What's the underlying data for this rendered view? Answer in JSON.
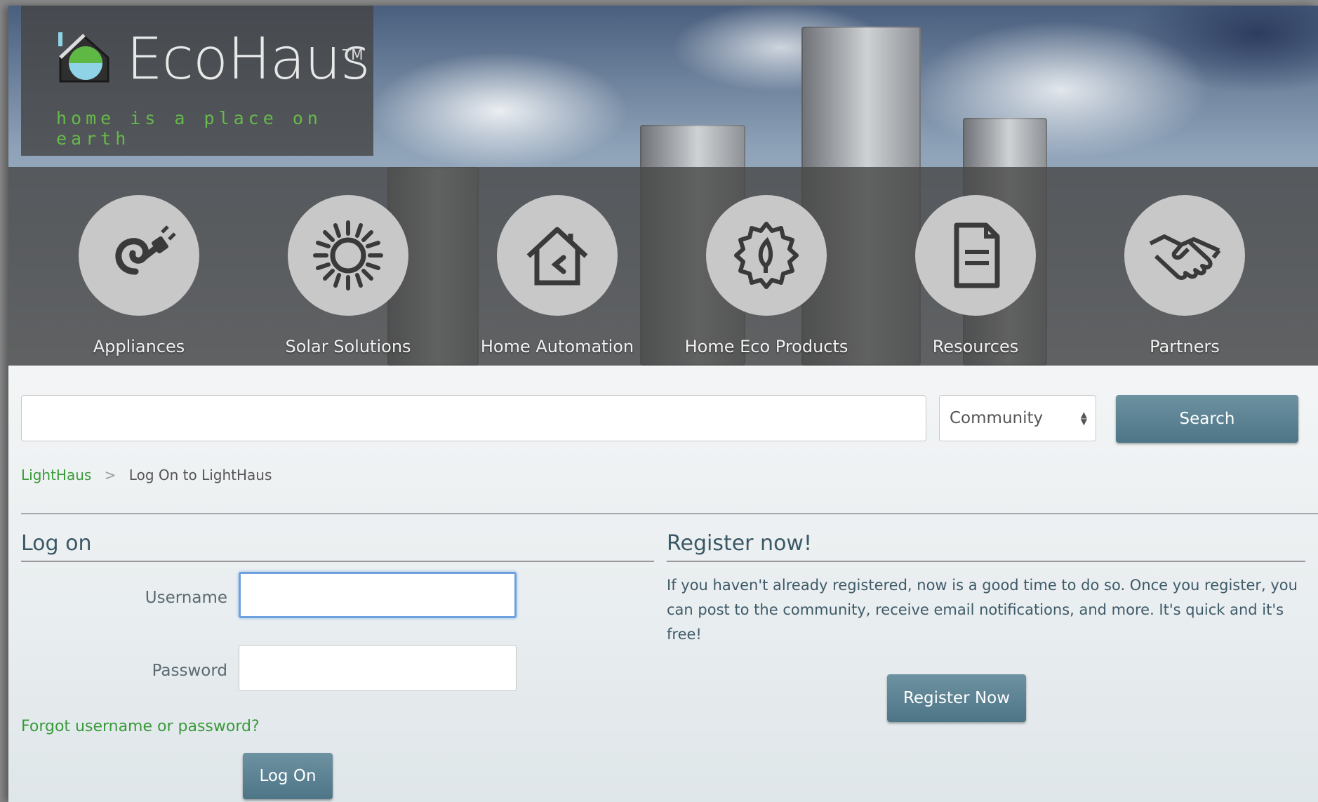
{
  "brand": {
    "name": "EcoHaus",
    "trademark": "TM",
    "tagline": "home is a place on earth"
  },
  "nav": [
    {
      "label": "Appliances",
      "icon": "plug-swirl-icon"
    },
    {
      "label": "Solar Solutions",
      "icon": "sun-icon"
    },
    {
      "label": "Home Automation",
      "icon": "house-icon"
    },
    {
      "label": "Home Eco Products",
      "icon": "eco-seal-icon"
    },
    {
      "label": "Resources",
      "icon": "document-icon"
    },
    {
      "label": "Partners",
      "icon": "handshake-icon"
    }
  ],
  "search": {
    "query": "",
    "scope": "Community",
    "button": "Search"
  },
  "breadcrumb": {
    "home": "LightHaus",
    "current": "Log On to LightHaus"
  },
  "logon": {
    "title": "Log on",
    "username_label": "Username",
    "password_label": "Password",
    "forgot": "Forgot username or password?",
    "button": "Log On"
  },
  "register": {
    "title": "Register now!",
    "text": "If you haven't already registered, now is a good time to do so. Once you register, you can post to the community, receive email notifications, and more. It's quick and it's free!",
    "button": "Register Now"
  },
  "colors": {
    "accent_green": "#3a9a3a",
    "button_teal": "#5a8293",
    "heading": "#3b5866"
  }
}
